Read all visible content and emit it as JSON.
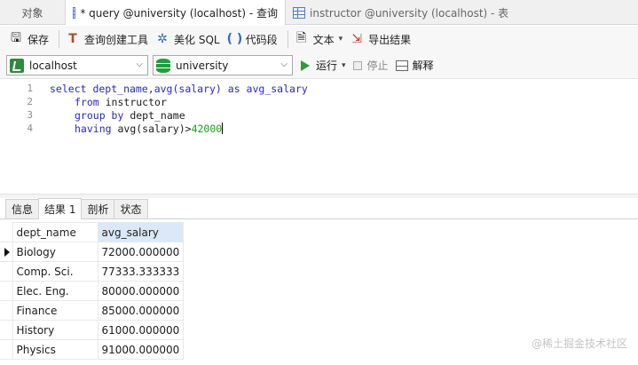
{
  "tabs": [
    {
      "label": "对象"
    },
    {
      "label": "* query @university (localhost) - 查询"
    },
    {
      "label": "instructor @university (localhost) - 表"
    }
  ],
  "toolbar1": {
    "save": "保存",
    "query_builder": "查询创建工具",
    "beautify": "美化 SQL",
    "snippet": "代码段",
    "text": "文本",
    "export": "导出结果"
  },
  "toolbar2": {
    "connection": "localhost",
    "database": "university",
    "run": "运行",
    "stop": "停止",
    "explain": "解释"
  },
  "editor": {
    "lines": [
      {
        "num": "1",
        "t1": "select dept_name,avg(salary) as avg_salary"
      },
      {
        "num": "2",
        "kw": "from",
        "t2": " instructor"
      },
      {
        "num": "3",
        "kw": "group by",
        "t2": " dept_name"
      },
      {
        "num": "4",
        "kw": "having",
        "t2": " avg(salary)>",
        "num_lit": "42000"
      }
    ]
  },
  "result_tabs": [
    "信息",
    "结果 1",
    "剖析",
    "状态"
  ],
  "result_grid": {
    "columns": [
      "dept_name",
      "avg_salary"
    ],
    "rows": [
      [
        "Biology",
        "72000.000000"
      ],
      [
        "Comp. Sci.",
        "77333.333333"
      ],
      [
        "Elec. Eng.",
        "80000.000000"
      ],
      [
        "Finance",
        "85000.000000"
      ],
      [
        "History",
        "61000.000000"
      ],
      [
        "Physics",
        "91000.000000"
      ]
    ]
  },
  "watermark": "@稀土掘金技术社区",
  "colors": {
    "keyword": "#2828c8",
    "number": "#11a211",
    "run": "#2e9b3c"
  }
}
